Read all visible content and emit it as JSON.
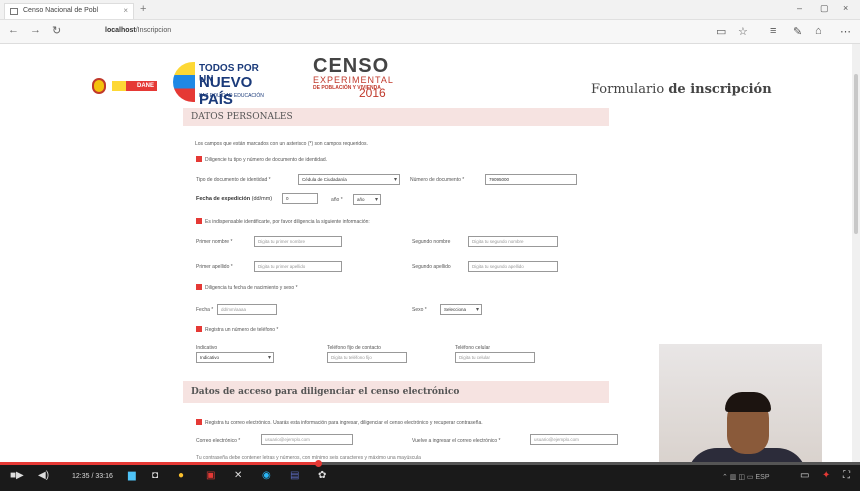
{
  "browser": {
    "tab_title": "Censo Nacional de Pobl",
    "tab_close": "×",
    "new_tab": "+",
    "win_min": "–",
    "win_max": "▢",
    "win_close": "×",
    "back": "←",
    "forward": "→",
    "refresh": "↻",
    "url_host": "localhost",
    "url_path": "/Inscripcion",
    "icons": [
      "reading-view-icon",
      "favorite-star-icon",
      "hub-icon",
      "web-note-icon",
      "share-icon",
      "more-icon"
    ]
  },
  "header": {
    "dane_label": "DANE",
    "npais_line1": "TODOS POR UN",
    "npais_line2": "NUEVO PAÍS",
    "npais_line3": "PAZ   EQUIDAD   EDUCACIÓN",
    "censo_title": "CENSO",
    "censo_sub": "EXPERIMENTAL",
    "censo_small": "DE POBLACIÓN Y VIVIENDA",
    "censo_year": "2016",
    "form_title_plain": "Formulario",
    "form_title_bold": "de inscripción"
  },
  "form": {
    "section1_title": "DATOS PERSONALES",
    "required_note": "Los campos que están marcados con un asterisco (*) son campos requeridos.",
    "doc_instruction": "Diligencie tu tipo y número de documento de identidad.",
    "doc_type_label": "Tipo de documento de identidad *",
    "doc_type_value": "Cédula de Ciudadanía",
    "doc_number_label": "Número de documento *",
    "doc_number_value": "79095000",
    "exp_date_label": "Fecha de expedición",
    "exp_date_hint": "(dd/mm)",
    "exp_date_value": "0",
    "year_label": "año *",
    "year_value": "año",
    "identify_instruction": "Es indispensable identificarte, por favor diligencia la siguiente información:",
    "first_name_label": "Primer nombre *",
    "first_name_placeholder": "Digita tu primer nombre",
    "second_name_label": "Segundo nombre",
    "second_name_placeholder": "Digita tu segundo nombre",
    "first_surname_label": "Primer apellido *",
    "first_surname_placeholder": "Digita tu primer apellido",
    "second_surname_label": "Segundo apellido",
    "second_surname_placeholder": "Digita tu segundo apellido",
    "birth_instruction": "Diligencia tu fecha de nacimiento y sexo *",
    "date_label": "Fecha *",
    "date_placeholder": "dd/mm/aaaa",
    "sex_label": "Sexo *",
    "sex_value": "Selecciona",
    "phone_instruction": "Registra un número de teléfono *",
    "indicativo_label": "Indicativo",
    "indicativo_value": "Indicativo",
    "landline_label": "Teléfono fijo de contacto",
    "landline_placeholder": "Digita tu teléfono fijo",
    "mobile_label": "Teléfono celular",
    "mobile_placeholder": "Digita tu celular",
    "section2_title": "Datos de acceso para diligenciar el censo electrónico",
    "email_instruction": "Registra tu correo electrónico. Usarás esta información para ingresar, diligenciar el censo electrónico y recuperar contraseña.",
    "email_label": "Correo electrónico *",
    "email_placeholder": "usuario@ejemplo.com",
    "email_confirm_label": "Vuelve a ingresar el correo electrónico *",
    "email_confirm_placeholder": "usuario@ejemplo.com",
    "password_note": "Tu contraseña debe contener letras y números, con mínimo seis caracteres y máximo una mayúscula"
  },
  "taskbar": {
    "time_current": "12:35",
    "time_total": "33:16",
    "progress_fraction": 0.37,
    "icons": [
      "start-icon",
      "volume-icon",
      "file-explorer-icon",
      "store-icon",
      "chrome-icon",
      "app-icon",
      "app2-icon",
      "edge-icon",
      "app3-icon",
      "settings-icon"
    ]
  }
}
